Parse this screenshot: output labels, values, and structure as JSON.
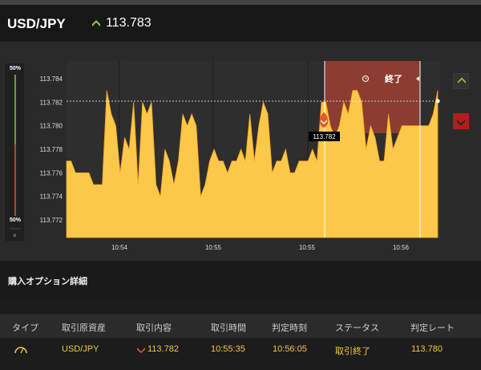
{
  "header": {
    "pair": "USD/JPY",
    "rate": "113.783",
    "direction_icon": "up-arrow-icon",
    "up_color": "#8bc34a"
  },
  "chart": {
    "y_ticks": [
      "113.784",
      "113.782",
      "113.780",
      "113.778",
      "113.776",
      "113.774",
      "113.772"
    ],
    "x_ticks": [
      "10:54",
      "10:55",
      "10:55",
      "10:56"
    ],
    "entry_label": "113.782",
    "expiry_label": "終了",
    "expiry_icon": "clock-history-icon",
    "ratio_top": "50%",
    "ratio_bottom": "50%",
    "close_label": "×",
    "fill_color": "#fcc84a",
    "expiry_zone_color": "#8a3d30"
  },
  "chart_data": {
    "type": "area",
    "ylim": [
      113.7705,
      113.7855
    ],
    "values": [
      113.777,
      113.777,
      113.776,
      113.776,
      113.776,
      113.776,
      113.775,
      113.775,
      113.775,
      113.783,
      113.781,
      113.78,
      113.776,
      113.779,
      113.778,
      113.782,
      113.775,
      113.782,
      113.781,
      113.782,
      113.775,
      113.774,
      113.778,
      113.777,
      113.775,
      113.777,
      113.781,
      113.78,
      113.781,
      113.78,
      113.774,
      113.775,
      113.777,
      113.778,
      113.777,
      113.777,
      113.776,
      113.777,
      113.777,
      113.778,
      113.777,
      113.781,
      113.777,
      113.78,
      113.782,
      113.781,
      113.776,
      113.777,
      113.777,
      113.778,
      113.776,
      113.776,
      113.777,
      113.777,
      113.777,
      113.778,
      113.777,
      113.782,
      113.782,
      113.78,
      113.779,
      113.78,
      113.782,
      113.781,
      113.783,
      113.783,
      113.782,
      113.778,
      113.78,
      113.779,
      113.777,
      113.777,
      113.781,
      113.778,
      113.779,
      113.78,
      113.78,
      113.78,
      113.78,
      113.78,
      113.78,
      113.78,
      113.781,
      113.783
    ]
  },
  "buttons": {
    "call_icon": "chevron-up-icon",
    "put_icon": "chevron-down-icon"
  },
  "section": {
    "title": "購入オプション詳細"
  },
  "table": {
    "headers": [
      "タイプ",
      "取引原資産",
      "取引内容",
      "取引時間",
      "判定時刻",
      "ステータス",
      "判定レート"
    ],
    "row": {
      "type_icon": "gauge-icon",
      "asset": "USD/JPY",
      "direction_icon": "down-arrow-icon",
      "rate": "113.782",
      "time": "10:55:35",
      "judge_time": "10:56:05",
      "status": "取引終了",
      "judge_rate": "113.780"
    }
  }
}
